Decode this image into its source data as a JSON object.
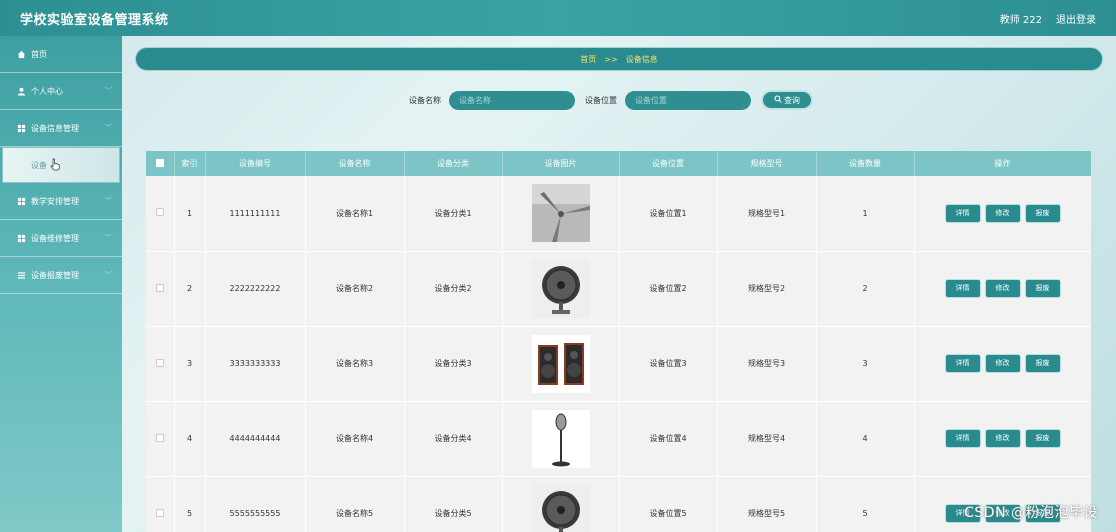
{
  "app": {
    "title": "学校实验室设备管理系统"
  },
  "topbar": {
    "user_label": "教师 222",
    "logout_label": "退出登录"
  },
  "sidebar": {
    "items": [
      {
        "label": "首页",
        "icon": "home-icon"
      },
      {
        "label": "个人中心",
        "icon": "user-icon"
      },
      {
        "label": "设备信息管理",
        "icon": "grid-icon"
      },
      {
        "label": "设备",
        "icon": "",
        "sub": true
      },
      {
        "label": "教学安排管理",
        "icon": "grid-icon"
      },
      {
        "label": "设备维修管理",
        "icon": "grid-icon"
      },
      {
        "label": "设备报废管理",
        "icon": "list-icon"
      }
    ]
  },
  "breadcrumb": {
    "home": "首页",
    "sep": ">>",
    "current": "设备信息"
  },
  "search": {
    "name_label": "设备名称",
    "name_placeholder": "设备名称",
    "location_label": "设备位置",
    "location_placeholder": "设备位置",
    "button_label": "查询"
  },
  "table": {
    "headers": [
      "索引",
      "设备编号",
      "设备名称",
      "设备分类",
      "设备图片",
      "设备位置",
      "规格型号",
      "设备数量",
      "操作"
    ],
    "actions": [
      "详情",
      "修改",
      "报废"
    ],
    "rows": [
      {
        "index": "1",
        "code": "1111111111",
        "name": "设备名称1",
        "category": "设备分类1",
        "image": "ceiling-fan",
        "location": "设备位置1",
        "model": "规格型号1",
        "qty": "1"
      },
      {
        "index": "2",
        "code": "2222222222",
        "name": "设备名称2",
        "category": "设备分类2",
        "image": "wall-fan",
        "location": "设备位置2",
        "model": "规格型号2",
        "qty": "2"
      },
      {
        "index": "3",
        "code": "3333333333",
        "name": "设备名称3",
        "category": "设备分类3",
        "image": "speakers",
        "location": "设备位置3",
        "model": "规格型号3",
        "qty": "3"
      },
      {
        "index": "4",
        "code": "4444444444",
        "name": "设备名称4",
        "category": "设备分类4",
        "image": "microphone",
        "location": "设备位置4",
        "model": "规格型号4",
        "qty": "4"
      },
      {
        "index": "5",
        "code": "5555555555",
        "name": "设备名称5",
        "category": "设备分类5",
        "image": "wall-fan",
        "location": "设备位置5",
        "model": "规格型号5",
        "qty": "5"
      }
    ]
  },
  "watermark": "CSDN @粉泡泡毕设",
  "colors": {
    "accent": "#2a8b8e",
    "header": "#7cc4c6",
    "breadcrumb_text": "#f5e26b"
  }
}
